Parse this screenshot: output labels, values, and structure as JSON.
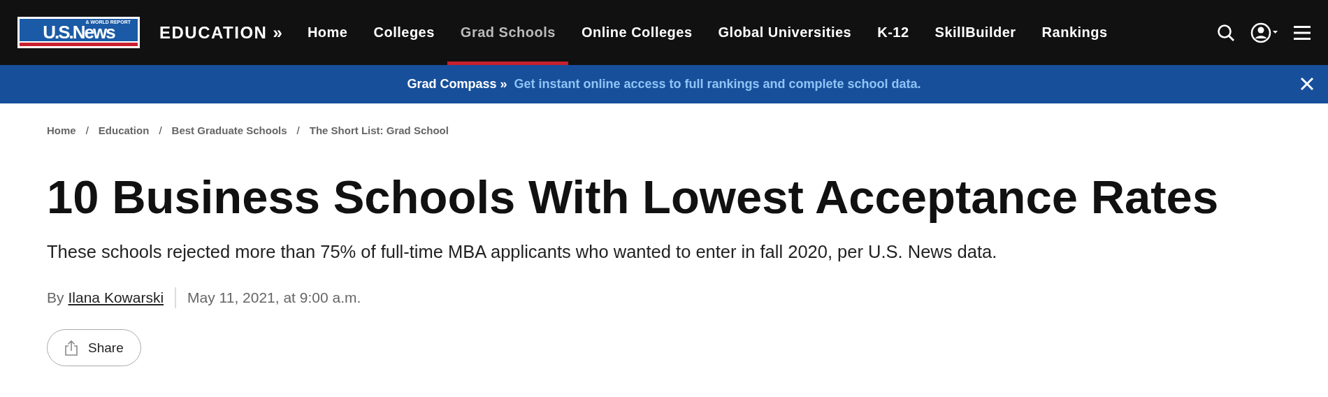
{
  "logo": {
    "name": "U.S.News",
    "tagline": "& WORLD REPORT"
  },
  "section": "EDUCATION »",
  "nav": [
    {
      "label": "Home",
      "selected": false
    },
    {
      "label": "Colleges",
      "selected": false
    },
    {
      "label": "Grad Schools",
      "selected": true
    },
    {
      "label": "Online Colleges",
      "selected": false
    },
    {
      "label": "Global Universities",
      "selected": false
    },
    {
      "label": "K-12",
      "selected": false
    },
    {
      "label": "SkillBuilder",
      "selected": false
    },
    {
      "label": "Rankings",
      "selected": false
    }
  ],
  "promo": {
    "title": "Grad Compass »",
    "link": "Get instant online access to full rankings and complete school data."
  },
  "breadcrumb": [
    {
      "kind": "link",
      "label": "Home"
    },
    {
      "kind": "separator",
      "label": "/"
    },
    {
      "kind": "link",
      "label": "Education"
    },
    {
      "kind": "separator",
      "label": "/"
    },
    {
      "kind": "link",
      "label": "Best Graduate Schools"
    },
    {
      "kind": "separator",
      "label": "/"
    },
    {
      "kind": "link",
      "label": "The Short List: Grad School"
    }
  ],
  "article": {
    "title": "10 Business Schools With Lowest Acceptance Rates",
    "subtitle": "These schools rejected more than 75% of full-time MBA applicants who wanted to enter in fall 2020, per U.S. News data.",
    "by": "By",
    "author": "Ilana Kowarski",
    "date": "May 11, 2021, at 9:00 a.m.",
    "share": "Share"
  }
}
